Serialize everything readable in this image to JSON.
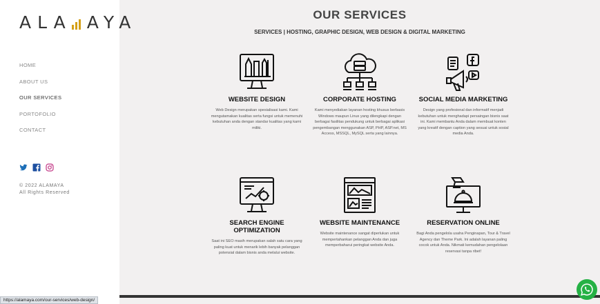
{
  "brand": {
    "logo_text_left": "ALA",
    "logo_text_right": "AYA",
    "accent": "#d4a017"
  },
  "nav": [
    {
      "label": "HOME",
      "active": false
    },
    {
      "label": "ABOUT US",
      "active": false
    },
    {
      "label": "OUR SERVICES",
      "active": true
    },
    {
      "label": "PORTOFOLIO",
      "active": false
    },
    {
      "label": "CONTACT",
      "active": false
    }
  ],
  "social": [
    "twitter-icon",
    "facebook-icon",
    "instagram-icon"
  ],
  "footer": {
    "copyright": "© 2022 ALAMAYA",
    "rights": "All Rights Reserved"
  },
  "page": {
    "title": "OUR SERVICES",
    "subtitle": "SERVICES | HOSTING, GRAPHIC DESIGN, WEB DESIGN & DIGITAL MARKETING"
  },
  "services": [
    {
      "icon": "website-design-icon",
      "title": "WEBSITE DESIGN",
      "desc": "Web Design merupakan spesialisasi kami. Kami mengutamakan kualitas serta fungsi untuk memenuhi kebutuhan anda dengan standar kualitas yang kami miliki."
    },
    {
      "icon": "cloud-hosting-icon",
      "title": "CORPORATE HOSTING",
      "desc": "Kami menyediakan layanan hosting khusus berbasis Windows maupun Linux yang dilengkapi dengan berbagai fasilitas pendukung untuk berbagai aplikasi pengembangan menggunakan ASP, PHP, ASP.net, MS Access, MSSQL, MySQL serta yang lainnya."
    },
    {
      "icon": "megaphone-icon",
      "title": "SOCIAL MEDIA MARKETING",
      "desc": "Design yang profesional dan informatif menjadi kebutuhan untuk menghadapi persaingan bisnis saat ini. Kami membantu Anda dalam membuat konten yang kreatif dengan caption yang sesuai untuk sosial media Anda."
    },
    {
      "icon": "seo-monitor-icon",
      "title": "SEARCH ENGINE OPTIMIZATION",
      "desc": "Saat ini SEO masih merupakan salah satu cara yang paling kuat untuk menarik lebih banyak pelanggan potensial dalam bisnis anda melalui website."
    },
    {
      "icon": "website-maintenance-icon",
      "title": "WEBSITE MAINTENANCE",
      "desc": "Website maintenance sangat diperlukan untuk mempertahankan pelanggan Anda dan juga memperbaharui peringkat website Anda."
    },
    {
      "icon": "reservation-bell-icon",
      "title": "RESERVATION ONLINE",
      "desc": "Bagi Anda pengelola usaha Penginapan, Tour & Travel Agency dan Theme Park. Ini adalah layanan paling cocok untuk Anda. Nikmati kemudahan pengelolaan reservasi tanpa ribet!"
    }
  ],
  "status_url": "https://alamaya.com/our-services/web-design/",
  "whatsapp": {
    "icon": "whatsapp-icon",
    "color": "#25b145"
  }
}
